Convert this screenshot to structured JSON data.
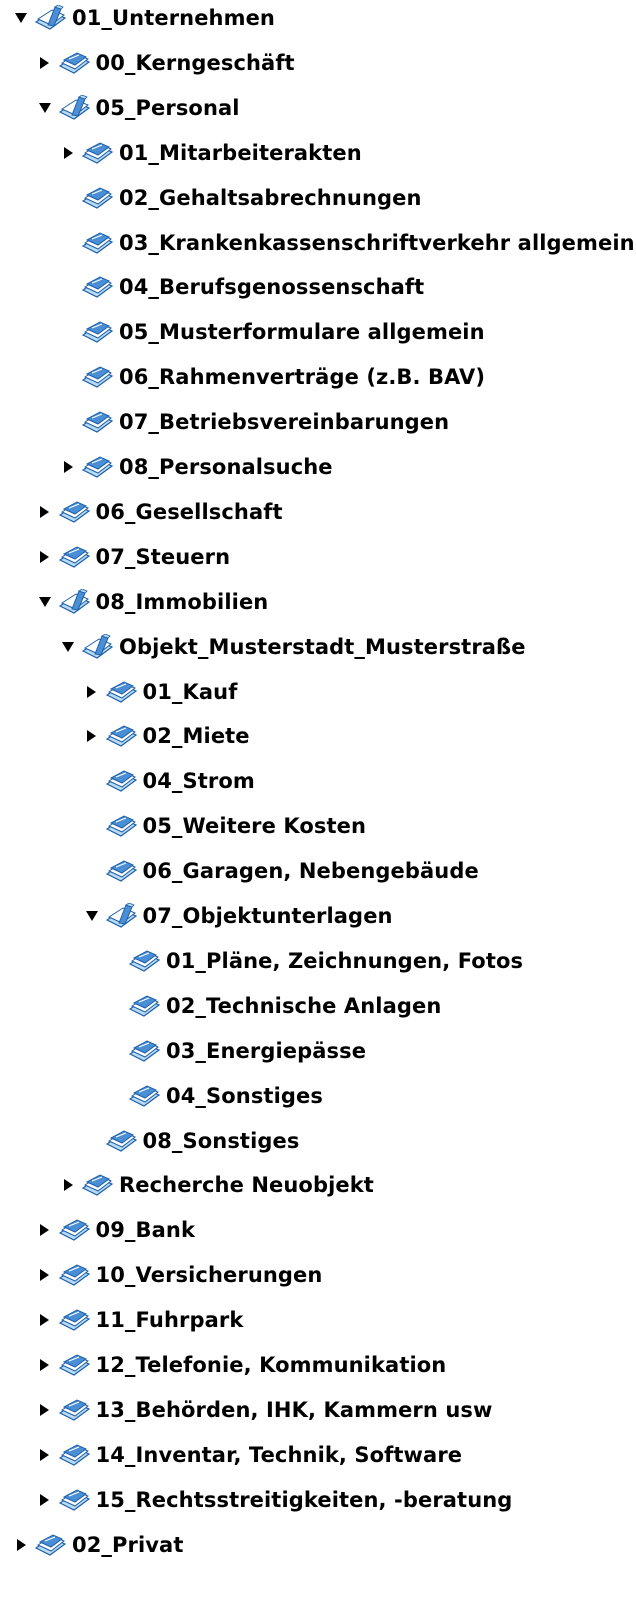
{
  "colors": {
    "folder_body": "#4a8fd6",
    "folder_light": "#b9dbf7",
    "folder_dark": "#1e5fa8",
    "arrow": "#000000"
  },
  "tree": [
    {
      "label": "01_Unternehmen",
      "depth": 0,
      "state": "expanded"
    },
    {
      "label": "00_Kerngeschäft",
      "depth": 1,
      "state": "collapsed"
    },
    {
      "label": "05_Personal",
      "depth": 1,
      "state": "expanded"
    },
    {
      "label": "01_Mitarbeiterakten",
      "depth": 2,
      "state": "collapsed"
    },
    {
      "label": "02_Gehaltsabrechnungen",
      "depth": 2,
      "state": "leaf"
    },
    {
      "label": "03_Krankenkassenschriftverkehr allgemein",
      "depth": 2,
      "state": "leaf"
    },
    {
      "label": "04_Berufsgenossenschaft",
      "depth": 2,
      "state": "leaf"
    },
    {
      "label": "05_Musterformulare allgemein",
      "depth": 2,
      "state": "leaf"
    },
    {
      "label": "06_Rahmenverträge (z.B. BAV)",
      "depth": 2,
      "state": "leaf"
    },
    {
      "label": "07_Betriebsvereinbarungen",
      "depth": 2,
      "state": "leaf"
    },
    {
      "label": "08_Personalsuche",
      "depth": 2,
      "state": "collapsed"
    },
    {
      "label": "06_Gesellschaft",
      "depth": 1,
      "state": "collapsed"
    },
    {
      "label": "07_Steuern",
      "depth": 1,
      "state": "collapsed"
    },
    {
      "label": "08_Immobilien",
      "depth": 1,
      "state": "expanded"
    },
    {
      "label": "Objekt_Musterstadt_Musterstraße",
      "depth": 2,
      "state": "expanded"
    },
    {
      "label": "01_Kauf",
      "depth": 3,
      "state": "collapsed"
    },
    {
      "label": "02_Miete",
      "depth": 3,
      "state": "collapsed"
    },
    {
      "label": "04_Strom",
      "depth": 3,
      "state": "leaf"
    },
    {
      "label": "05_Weitere Kosten",
      "depth": 3,
      "state": "leaf"
    },
    {
      "label": "06_Garagen, Nebengebäude",
      "depth": 3,
      "state": "leaf"
    },
    {
      "label": "07_Objektunterlagen",
      "depth": 3,
      "state": "expanded"
    },
    {
      "label": "01_Pläne, Zeichnungen, Fotos",
      "depth": 4,
      "state": "leaf"
    },
    {
      "label": "02_Technische Anlagen",
      "depth": 4,
      "state": "leaf"
    },
    {
      "label": "03_Energiepässe",
      "depth": 4,
      "state": "leaf"
    },
    {
      "label": "04_Sonstiges",
      "depth": 4,
      "state": "leaf"
    },
    {
      "label": "08_Sonstiges",
      "depth": 3,
      "state": "leaf"
    },
    {
      "label": "Recherche Neuobjekt",
      "depth": 2,
      "state": "collapsed"
    },
    {
      "label": "09_Bank",
      "depth": 1,
      "state": "collapsed"
    },
    {
      "label": "10_Versicherungen",
      "depth": 1,
      "state": "collapsed"
    },
    {
      "label": "11_Fuhrpark",
      "depth": 1,
      "state": "collapsed"
    },
    {
      "label": "12_Telefonie, Kommunikation",
      "depth": 1,
      "state": "collapsed"
    },
    {
      "label": "13_Behörden, IHK, Kammern usw",
      "depth": 1,
      "state": "collapsed"
    },
    {
      "label": "14_Inventar, Technik, Software",
      "depth": 1,
      "state": "collapsed"
    },
    {
      "label": "15_Rechtsstreitigkeiten, -beratung",
      "depth": 1,
      "state": "collapsed"
    },
    {
      "label": "02_Privat",
      "depth": 0,
      "state": "collapsed"
    }
  ]
}
